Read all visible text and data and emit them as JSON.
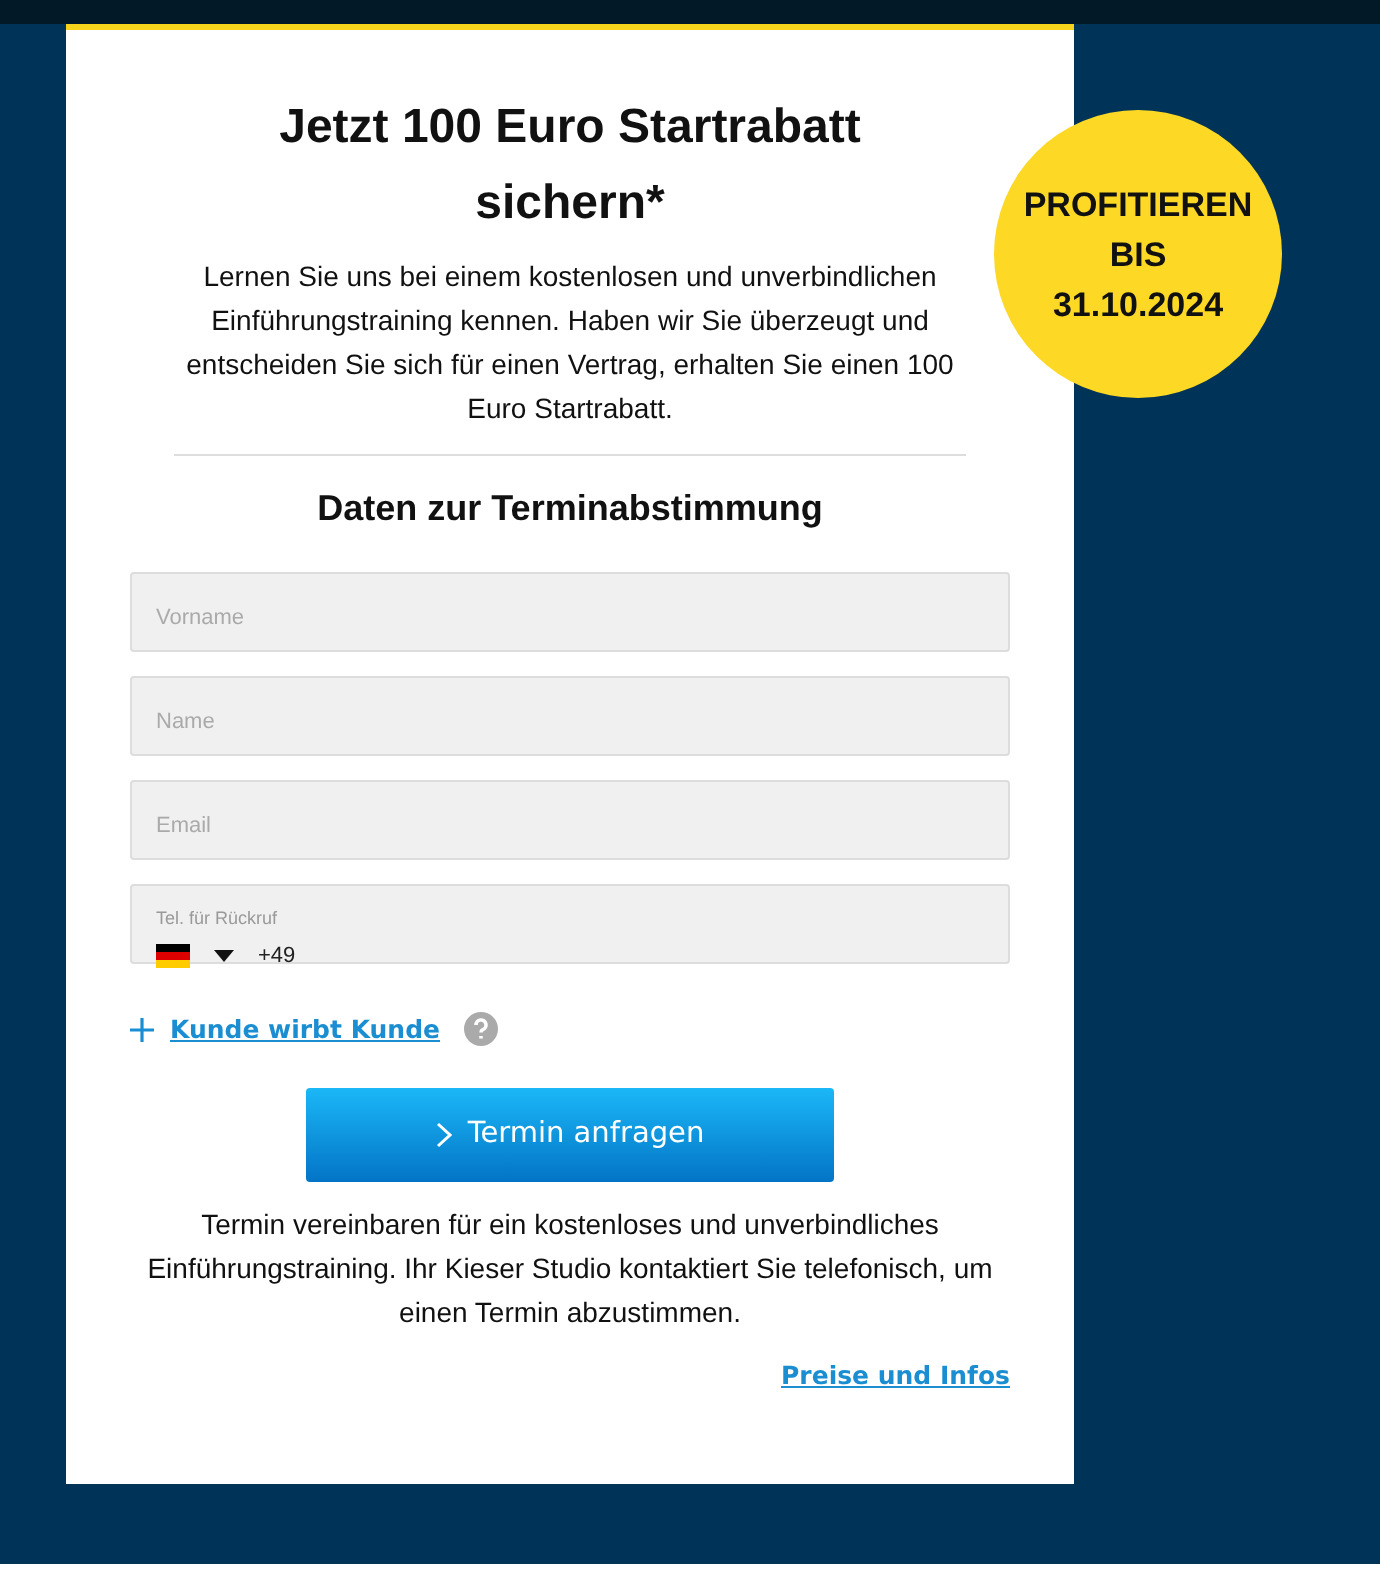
{
  "offer": {
    "title": "Jetzt 100 Euro Startrabatt sichern*",
    "intro": "Lernen Sie uns bei einem kostenlosen und unverbindlichen Einführungstraining kennen. Haben wir Sie überzeugt und entscheiden Sie sich für einen Vertrag, erhalten Sie einen 100 Euro Startrabatt."
  },
  "badge": {
    "lines": [
      "PROFITIEREN",
      "BIS",
      "31.10.2024"
    ]
  },
  "form": {
    "heading": "Daten zur Terminabstimmung",
    "fields": [
      {
        "kind": "text",
        "placeholder": "Vorname"
      },
      {
        "kind": "text",
        "placeholder": "Name"
      },
      {
        "kind": "text",
        "placeholder": "Email"
      },
      {
        "kind": "phone",
        "label": "Tel. für Rückruf",
        "value": "+49"
      }
    ],
    "referral_link": "Kunde wirbt Kunde",
    "submit": "Termin anfragen",
    "note": "Termin vereinbaren für ein kostenloses und unverbindliches Einführungstraining. Ihr Kieser Studio kontaktiert Sie telefonisch, um einen Termin abzustimmen.",
    "info_link": "Preise und Infos"
  }
}
